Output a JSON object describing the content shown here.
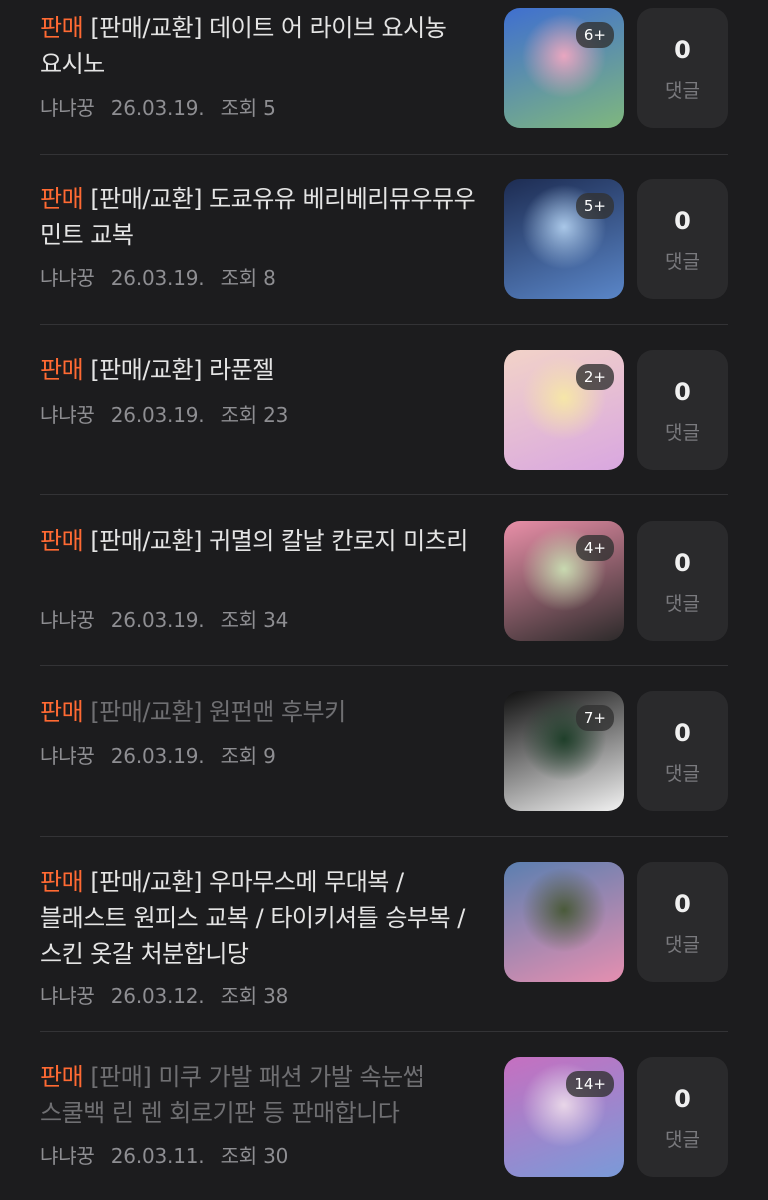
{
  "posts": [
    {
      "tag": "판매",
      "category": "[판매/교환]",
      "title": "데이트 어 라이브 요시농 요시노",
      "author": "냐냐꿍",
      "date": "26.03.19.",
      "views": "조회 5",
      "image_count": "6+",
      "comment_count": "0",
      "comment_label": "댓글",
      "thumb_colors": [
        "#3f6fd0",
        "#7fb77e",
        "#e9a6c0"
      ]
    },
    {
      "tag": "판매",
      "category": "[판매/교환]",
      "title": "도쿄유유 베리베리뮤우뮤우 민트 교복",
      "author": "냐냐꿍",
      "date": "26.03.19.",
      "views": "조회 8",
      "image_count": "5+",
      "comment_count": "0",
      "comment_label": "댓글",
      "thumb_colors": [
        "#1d2c52",
        "#5a86c8",
        "#a9c7e8"
      ]
    },
    {
      "tag": "판매",
      "category": "[판매/교환]",
      "title": "라푼젤",
      "author": "냐냐꿍",
      "date": "26.03.19.",
      "views": "조회 23",
      "image_count": "2+",
      "comment_count": "0",
      "comment_label": "댓글",
      "thumb_colors": [
        "#f2d3c8",
        "#d9a7e0",
        "#f6e6a8"
      ]
    },
    {
      "tag": "판매",
      "category": "[판매/교환]",
      "title": "귀멸의 칼날 칸로지 미츠리",
      "author": "냐냐꿍",
      "date": "26.03.19.",
      "views": "조회 34",
      "image_count": "4+",
      "comment_count": "0",
      "comment_label": "댓글",
      "thumb_colors": [
        "#e98fa8",
        "#2c2a2a",
        "#c8d9b0"
      ]
    },
    {
      "tag": "판매",
      "category": "[판매/교환]",
      "title": "원펀맨 후부키",
      "author": "냐냐꿍",
      "date": "26.03.19.",
      "views": "조회 9",
      "image_count": "7+",
      "comment_count": "0",
      "comment_label": "댓글",
      "thumb_colors": [
        "#101010",
        "#f2f2f2",
        "#1f3f2a"
      ]
    },
    {
      "tag": "판매",
      "category": "[판매/교환]",
      "title": "우마무스메 무대복 / 블래스트 원피스 교복 / 타이키셔틀 승부복 / 스킨 옷갈 처분합니당",
      "author": "냐냐꿍",
      "date": "26.03.12.",
      "views": "조회 38",
      "image_count": "",
      "comment_count": "0",
      "comment_label": "댓글",
      "thumb_colors": [
        "#5b7fb0",
        "#e58fb0",
        "#4a5a3a"
      ]
    },
    {
      "tag": "판매",
      "category": "[판매]",
      "title": "미쿠 가발 패션 가발 속눈썹 스쿨백 린 렌 회로기판 등 판매합니다",
      "author": "냐냐꿍",
      "date": "26.03.11.",
      "views": "조회 30",
      "image_count": "14+",
      "comment_count": "0",
      "comment_label": "댓글",
      "thumb_colors": [
        "#c66fc0",
        "#7a9ad8",
        "#e8d6e8"
      ]
    }
  ]
}
